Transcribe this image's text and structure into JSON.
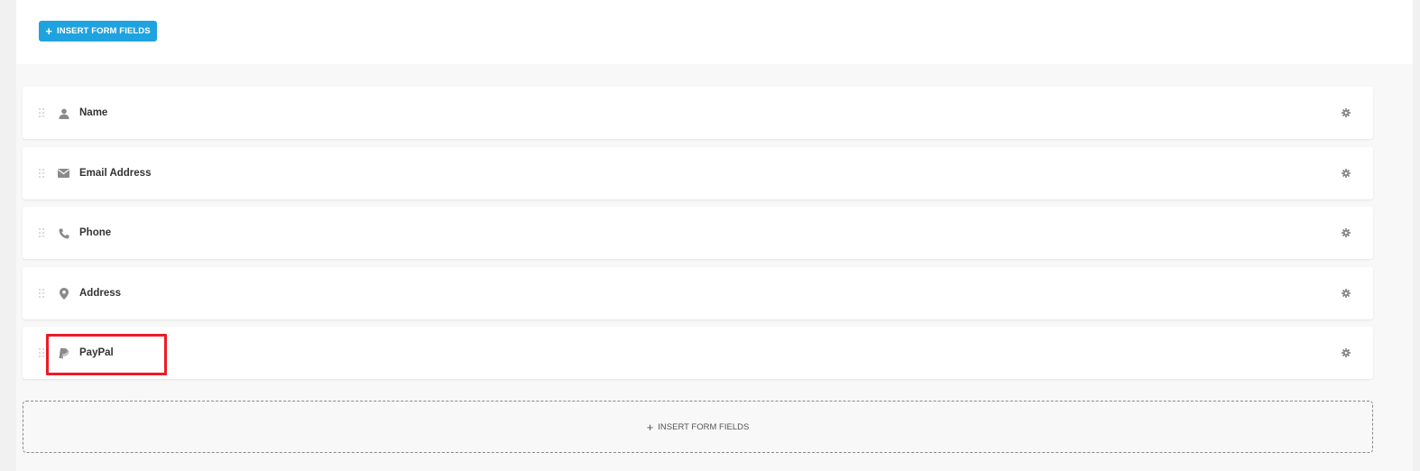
{
  "toolbar": {
    "insert_label": "INSERT FORM FIELDS",
    "plus": "+"
  },
  "fields": [
    {
      "label": "Name",
      "icon": "user-icon"
    },
    {
      "label": "Email Address",
      "icon": "envelope-icon"
    },
    {
      "label": "Phone",
      "icon": "phone-icon"
    },
    {
      "label": "Address",
      "icon": "map-marker-icon"
    },
    {
      "label": "PayPal",
      "icon": "paypal-icon"
    }
  ],
  "dropzone": {
    "insert_label": "INSERT FORM FIELDS",
    "plus": "+"
  },
  "colors": {
    "accent": "#1fa3e0",
    "highlight": "#ec1c24",
    "icon_gray": "#8a8a8a"
  }
}
